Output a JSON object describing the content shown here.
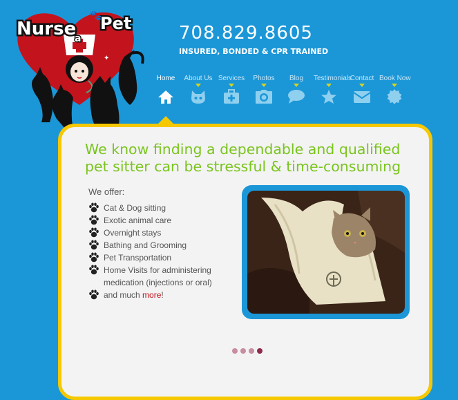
{
  "brand": {
    "word1": "Nurse",
    "word2": "a",
    "word3": "Pet",
    "phone": "708.829.8605",
    "tagline": "INSURED, BONDED & CPR TRAINED",
    "heart_color": "#c3141d"
  },
  "nav": {
    "items": [
      {
        "label": "Home",
        "icon": "home-icon",
        "active": true
      },
      {
        "label": "About Us",
        "icon": "cat-face-icon"
      },
      {
        "label": "Services",
        "icon": "medical-bag-icon"
      },
      {
        "label": "Photos",
        "icon": "camera-icon"
      },
      {
        "label": "Blog",
        "icon": "speech-bubble-icon"
      },
      {
        "label": "Testimonials",
        "icon": "star-icon"
      },
      {
        "label": "Contact",
        "icon": "envelope-icon"
      },
      {
        "label": "Book Now",
        "icon": "badge-icon"
      }
    ]
  },
  "main": {
    "headline": "We know finding a dependable and qualified pet sitter can be stressful & time-consuming",
    "offer_title": "We offer:",
    "offers": [
      "Cat & Dog sitting",
      "Exotic animal care",
      "Overnight stays",
      "Bathing and Grooming",
      "Pet Transportation",
      "Home Visits for administering medication (injections or oral)"
    ],
    "last_offer_prefix": "and much ",
    "more_link": "more",
    "last_offer_suffix": "!"
  },
  "slider": {
    "dot_count": 4,
    "active_index": 3
  },
  "colors": {
    "background": "#1b97d8",
    "frame": "#f6c800",
    "headline": "#7ac41d",
    "link": "#c0121c"
  }
}
